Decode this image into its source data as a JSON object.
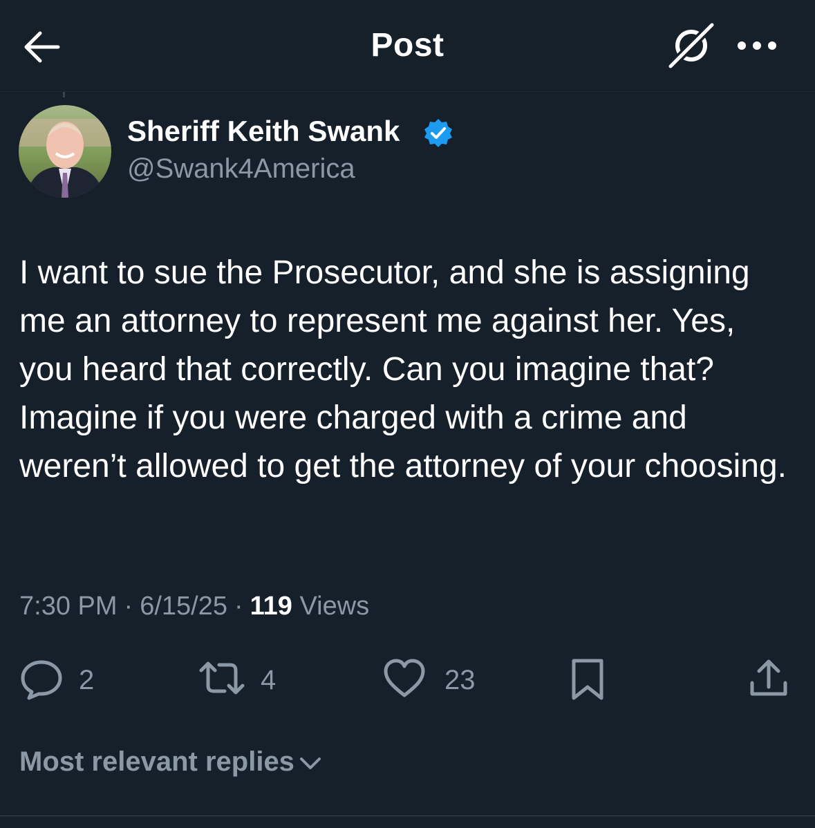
{
  "header": {
    "title": "Post",
    "back_icon": "arrow-left-icon",
    "grok_icon": "grok-icon",
    "more_icon": "more-horizontal-icon"
  },
  "author": {
    "name": "Sheriff Keith Swank",
    "handle": "@Swank4America",
    "verified": true,
    "verified_color": "#1d9bf0"
  },
  "post": {
    "text": "I want to sue the Prosecutor, and she is assigning me an attorney to represent me against her. Yes, you heard that correctly. Can you imagine that? Imagine if you were charged with a crime and weren’t allowed to get the attorney of your choosing.",
    "time": "7:30 PM",
    "date": "6/15/25",
    "views_count": "119",
    "views_label": "Views"
  },
  "actions": {
    "replies": "2",
    "reposts": "4",
    "likes": "23"
  },
  "replies_sort": {
    "label": "Most relevant replies"
  },
  "colors": {
    "background": "#15202b",
    "secondary_text": "#8b98a5",
    "accent": "#1d9bf0"
  }
}
